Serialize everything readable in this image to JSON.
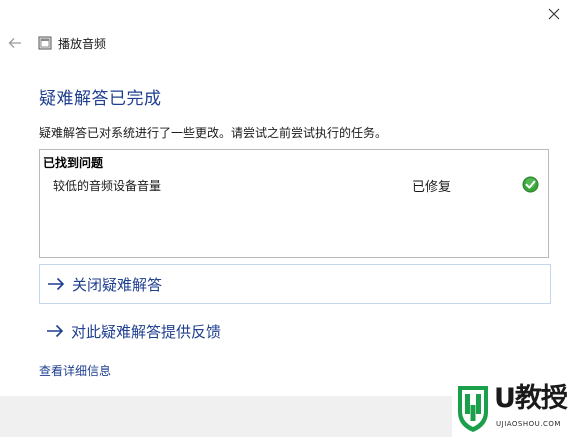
{
  "window": {
    "title": "播放音频"
  },
  "main": {
    "heading": "疑难解答已完成",
    "description": "疑难解答已对系统进行了一些更改。请尝试之前尝试执行的任务。",
    "problems": {
      "header": "已找到问题",
      "items": [
        {
          "name": "较低的音频设备音量",
          "status": "已修复",
          "status_icon": "green-check-icon"
        }
      ]
    },
    "actions": {
      "close": "关闭疑难解答",
      "feedback": "对此疑难解答提供反馈"
    },
    "details_link": "查看详细信息"
  },
  "watermark": {
    "brand": "U教授",
    "domain": "UJIAOSHOU.COM"
  },
  "colors": {
    "heading": "#1f3f8f",
    "link": "#1f3f8f",
    "footer_bg": "#f0f0f0",
    "box_border": "#b9b9b9",
    "success": "#3aa43a"
  }
}
